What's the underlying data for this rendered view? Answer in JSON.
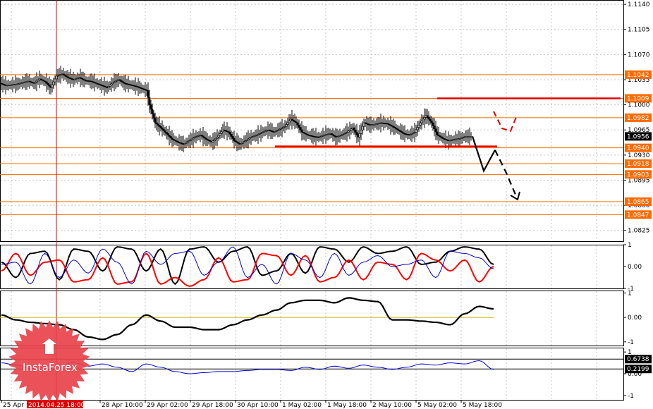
{
  "chart_data": {
    "type": "candlestick",
    "symbol_panel": {
      "price_ticks": [
        "1.1140",
        "1.1105",
        "1.1070",
        "1.1035",
        "1.1000",
        "1.0965",
        "1.0930",
        "1.0895",
        "1.0860",
        "1.0825"
      ],
      "ylim": [
        1.081,
        1.1146
      ],
      "level_tags": [
        {
          "label": "1.1042",
          "value": 1.1042,
          "color": "#ff6a00"
        },
        {
          "label": "1.1009",
          "value": 1.1009,
          "color": "#ff6a00"
        },
        {
          "label": "1.0982",
          "value": 1.0982,
          "color": "#ff6a00"
        },
        {
          "label": "1.0956",
          "value": 1.0956,
          "color": "#000000"
        },
        {
          "label": "1.0940",
          "value": 1.094,
          "color": "#ff6a00"
        },
        {
          "label": "1.0918",
          "value": 1.0918,
          "color": "#ff6a00"
        },
        {
          "label": "1.0903",
          "value": 1.0903,
          "color": "#ff6a00"
        },
        {
          "label": "1.0865",
          "value": 1.0865,
          "color": "#ff6a00"
        },
        {
          "label": "1.0847",
          "value": 1.0847,
          "color": "#ff6a00"
        }
      ],
      "resistance_line": 1.1009,
      "support_line": 1.094,
      "close_path": [
        [
          0,
          1.103
        ],
        [
          4,
          1.1027
        ],
        [
          8,
          1.1028
        ],
        [
          12,
          1.1029
        ],
        [
          16,
          1.1031
        ],
        [
          20,
          1.1033
        ],
        [
          24,
          1.103
        ],
        [
          28,
          1.1036
        ],
        [
          32,
          1.1032
        ],
        [
          36,
          1.1024
        ],
        [
          40,
          1.104
        ],
        [
          44,
          1.1043
        ],
        [
          48,
          1.1038
        ],
        [
          52,
          1.1035
        ],
        [
          56,
          1.1038
        ],
        [
          60,
          1.1034
        ],
        [
          64,
          1.1033
        ],
        [
          68,
          1.103
        ],
        [
          72,
          1.1027
        ],
        [
          76,
          1.1024
        ],
        [
          80,
          1.1031
        ],
        [
          84,
          1.1035
        ],
        [
          88,
          1.103
        ],
        [
          92,
          1.1028
        ],
        [
          96,
          1.1026
        ],
        [
          100,
          1.1023
        ],
        [
          104,
          1.102
        ],
        [
          106,
          1.1
        ],
        [
          110,
          1.0975
        ],
        [
          114,
          1.0968
        ],
        [
          118,
          1.096
        ],
        [
          122,
          1.0952
        ],
        [
          126,
          1.0948
        ],
        [
          130,
          1.0945
        ],
        [
          134,
          1.095
        ],
        [
          138,
          1.0955
        ],
        [
          142,
          1.0958
        ],
        [
          146,
          1.0952
        ],
        [
          150,
          1.0948
        ],
        [
          154,
          1.0955
        ],
        [
          158,
          1.0965
        ],
        [
          162,
          1.0962
        ],
        [
          166,
          1.095
        ],
        [
          170,
          1.0945
        ],
        [
          174,
          1.095
        ],
        [
          178,
          1.0955
        ],
        [
          182,
          1.0958
        ],
        [
          186,
          1.0962
        ],
        [
          190,
          1.0965
        ],
        [
          194,
          1.0962
        ],
        [
          198,
          1.0966
        ],
        [
          202,
          1.097
        ],
        [
          206,
          1.098
        ],
        [
          210,
          1.0975
        ],
        [
          214,
          1.0962
        ],
        [
          218,
          1.0958
        ],
        [
          222,
          1.0956
        ],
        [
          226,
          1.0955
        ],
        [
          230,
          1.0958
        ],
        [
          234,
          1.096
        ],
        [
          238,
          1.0955
        ],
        [
          242,
          1.0958
        ],
        [
          246,
          1.0962
        ],
        [
          250,
          1.0968
        ],
        [
          254,
          1.0955
        ],
        [
          258,
          1.0975
        ],
        [
          262,
          1.0972
        ],
        [
          266,
          1.0973
        ],
        [
          270,
          1.0975
        ],
        [
          274,
          1.0974
        ],
        [
          278,
          1.097
        ],
        [
          282,
          1.0965
        ],
        [
          286,
          1.096
        ],
        [
          290,
          1.0958
        ],
        [
          294,
          1.0962
        ],
        [
          298,
          1.0975
        ],
        [
          302,
          1.0985
        ],
        [
          306,
          1.0975
        ],
        [
          310,
          1.0958
        ],
        [
          314,
          1.0953
        ],
        [
          318,
          1.095
        ],
        [
          322,
          1.0952
        ],
        [
          326,
          1.0953
        ],
        [
          330,
          1.0956
        ],
        [
          334,
          1.0956
        ]
      ],
      "arrow_path": [
        [
          334,
          1.0956
        ],
        [
          342,
          1.0908
        ],
        [
          350,
          1.0937
        ]
      ],
      "dashed_path": [
        [
          350,
          1.0937
        ],
        [
          358,
          1.0905
        ],
        [
          366,
          1.0868
        ]
      ]
    },
    "stochastic_panel": {
      "ticks": [
        "1",
        "0.00",
        "-1"
      ],
      "ylim": [
        -1,
        1
      ],
      "series": [
        {
          "color": "#000000",
          "values": [
            0.2,
            -0.5,
            0.6,
            0.7,
            -0.6,
            0.8,
            0.7,
            -0.2,
            0.9,
            0.8,
            -0.2,
            0.8,
            -0.8,
            0.8,
            0.9,
            0.2,
            0.7,
            0.9,
            -0.4,
            -0.2,
            0.6,
            -0.3,
            0.9,
            0.8,
            0.2,
            0.9,
            0.6,
            0.7,
            0.9,
            0.1,
            0.2,
            0.7,
            0.9,
            0.8,
            0.1
          ]
        },
        {
          "color": "#ff0000",
          "values": [
            -0.2,
            0.6,
            -0.4,
            0.2,
            0.3,
            -0.7,
            -0.6,
            0.4,
            -0.8,
            -0.7,
            0.6,
            -0.8,
            -0.5,
            -0.9,
            -0.6,
            0.4,
            -0.7,
            -0.6,
            0.6,
            0.5,
            -0.4,
            0.5,
            -0.7,
            -0.5,
            0.3,
            -0.6,
            0.2,
            0.1,
            -0.6,
            0.6,
            0.3,
            -0.2,
            0.3,
            -0.7,
            0.0
          ]
        },
        {
          "color": "#0000cc",
          "values": [
            0.1,
            0.2,
            -0.8,
            0.6,
            -0.5,
            0.3,
            -0.3,
            0.8,
            0.2,
            -0.8,
            0.7,
            0.1,
            0.6,
            0.7,
            -0.4,
            0.2,
            0.9,
            -0.5,
            0.1,
            -0.8,
            0.6,
            0.3,
            -0.5,
            0.6,
            -0.4,
            0.2,
            0.5,
            0.0,
            0.1,
            0.3,
            -0.5,
            0.7,
            0.6,
            0.4,
            -0.1
          ]
        }
      ]
    },
    "oscillator_panel": {
      "ticks": [
        "1",
        "0.00",
        "-1"
      ],
      "ylim": [
        -1.15,
        1.1
      ],
      "baseline": 0.0,
      "values": [
        0.1,
        -0.1,
        -0.2,
        -0.25,
        -0.3,
        -0.5,
        -0.8,
        -0.9,
        -0.7,
        -0.3,
        0.1,
        -0.15,
        -0.4,
        -0.4,
        -0.5,
        -0.5,
        -0.3,
        -0.1,
        0.1,
        0.3,
        0.6,
        0.7,
        0.7,
        0.6,
        0.8,
        0.7,
        0.65,
        -0.1,
        -0.1,
        -0.15,
        -0.2,
        -0.3,
        0.15,
        0.45,
        0.35
      ]
    },
    "lower_panel": {
      "ticks": [
        "1",
        "0.00",
        "-1"
      ],
      "ylim": [
        -1.2,
        1.2
      ],
      "levels": [
        {
          "label": "0.6738",
          "value": 0.6738
        },
        {
          "label": "0.2199",
          "value": 0.2199
        }
      ],
      "values": [
        0.5,
        0.4,
        0.25,
        0.15,
        0.4,
        0.5,
        0.35,
        0.45,
        0.3,
        0.1,
        0.45,
        0.3,
        0.1,
        0.0,
        0.05,
        0.1,
        0.1,
        0.15,
        0.2,
        0.2,
        0.15,
        0.3,
        0.2,
        0.35,
        0.25,
        0.4,
        0.3,
        0.2,
        0.3,
        0.45,
        0.4,
        0.5,
        0.45,
        0.6,
        0.2
      ]
    },
    "x_ticks": [
      "25 Apr",
      "2014.04.25 18:00",
      "",
      "28 Apr 10:00",
      "29 Apr 02:00",
      "29 Apr 18:00",
      "30 Apr 10:00",
      "1 May 02:00",
      "1 May 18:00",
      "2 May 10:00",
      "5 May 02:00",
      "5 May 18:00"
    ],
    "cursor_label": "2014.04.25 18:00"
  },
  "branding": {
    "name": "InstaForex"
  },
  "colors": {
    "level": "#ff6a00",
    "trendline": "#e60000",
    "cursor": "#e00000",
    "grid": "#c8c8c8",
    "brand": "#e8424a"
  }
}
